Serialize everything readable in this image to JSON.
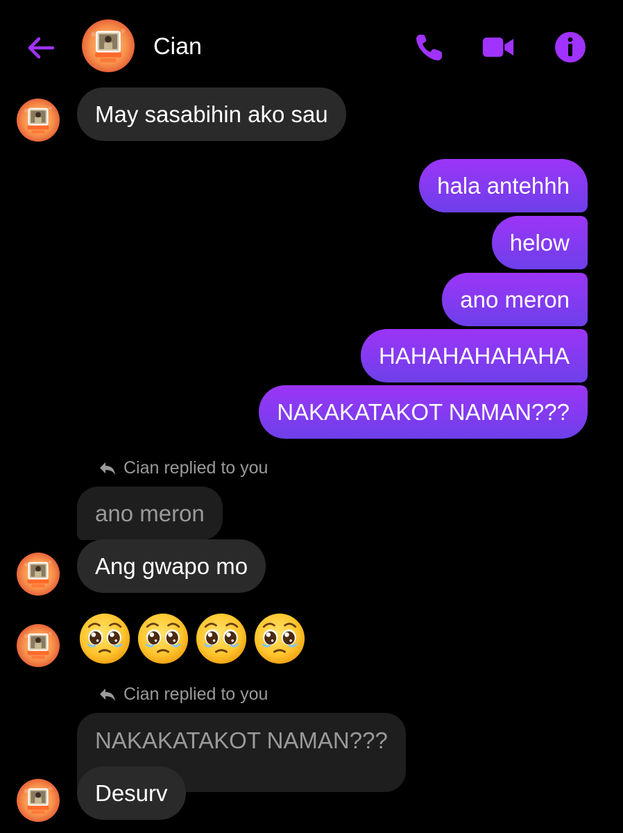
{
  "colors": {
    "accent": "#a033ff",
    "outgoing_top": "#9c35f7",
    "outgoing_bottom": "#6d40ea",
    "incoming": "#2a2a2a",
    "quoted": "#1e1e1e",
    "muted_text": "#9a9a9a"
  },
  "header": {
    "contact_name": "Cian",
    "back_icon": "arrow-left-icon",
    "call_icon": "phone-icon",
    "video_icon": "video-camera-icon",
    "info_icon": "info-icon"
  },
  "messages": {
    "m1": {
      "sender": "Cian",
      "text": "May sasabihin ako sau"
    },
    "outgoing": [
      "hala antehhh",
      "helow",
      "ano meron",
      "HAHAHAHAHAHA",
      "NAKAKATAKOT NAMAN???"
    ],
    "reply1": {
      "label": "Cian replied to you",
      "quoted": "ano meron",
      "text": "Ang gwapo mo"
    },
    "emoji_message": {
      "emoji_name": "pleading-face-emoji",
      "count": 4
    },
    "reply2": {
      "label": "Cian replied to you",
      "quoted": "NAKAKATAKOT NAMAN???",
      "text": "Desurv"
    }
  }
}
